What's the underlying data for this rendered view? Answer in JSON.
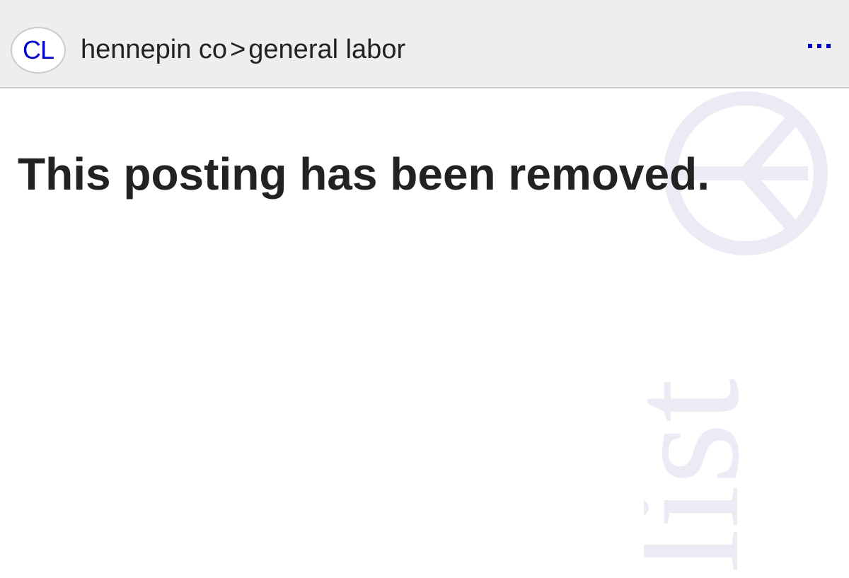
{
  "header": {
    "logo_text": "CL",
    "breadcrumb": {
      "area": "hennepin co",
      "separator": ">",
      "category": "general labor"
    },
    "menu_icon": "more-dots-icon"
  },
  "main": {
    "message": "This posting has been removed."
  },
  "watermark": {
    "icon": "peace-sign-icon",
    "text": "list"
  },
  "colors": {
    "header_bg": "#eeeeee",
    "link_blue": "#0000cc",
    "text": "#222222",
    "watermark": "#eceaf4"
  }
}
